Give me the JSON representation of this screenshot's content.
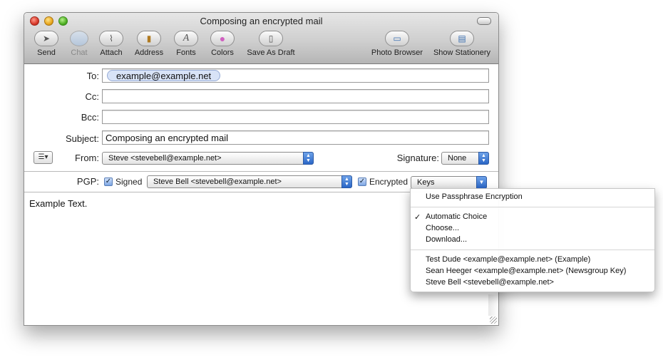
{
  "window": {
    "title": "Composing an encrypted mail"
  },
  "toolbar": {
    "items": [
      {
        "label": "Send",
        "icon": "send-icon",
        "glyph": "➤"
      },
      {
        "label": "Chat",
        "icon": "chat-icon",
        "glyph": ""
      },
      {
        "label": "Attach",
        "icon": "paperclip-icon",
        "glyph": "⌇"
      },
      {
        "label": "Address",
        "icon": "address-book-icon",
        "glyph": "▮"
      },
      {
        "label": "Fonts",
        "icon": "fonts-icon",
        "glyph": "A"
      },
      {
        "label": "Colors",
        "icon": "color-wheel-icon",
        "glyph": "●"
      },
      {
        "label": "Save As Draft",
        "icon": "draft-icon",
        "glyph": "▯"
      },
      {
        "label": "Photo Browser",
        "icon": "photo-browser-icon",
        "glyph": "▭"
      },
      {
        "label": "Show Stationery",
        "icon": "stationery-icon",
        "glyph": "▤"
      }
    ]
  },
  "header": {
    "to_label": "To:",
    "to_token": "example@example.net",
    "cc_label": "Cc:",
    "cc_value": "",
    "bcc_label": "Bcc:",
    "bcc_value": "",
    "subject_label": "Subject:",
    "subject_value": "Composing an encrypted mail",
    "from_label": "From:",
    "from_value": "Steve <stevebell@example.net>",
    "signature_label": "Signature:",
    "signature_value": "None"
  },
  "pgp": {
    "label": "PGP:",
    "signed_label": "Signed",
    "signed_checked": true,
    "signer_value": "Steve Bell <stevebell@example.net>",
    "encrypted_label": "Encrypted",
    "encrypted_checked": true,
    "keys_value": "Keys"
  },
  "body": {
    "text": "Example Text."
  },
  "keys_menu": {
    "passphrase": "Use Passphrase Encryption",
    "automatic": "Automatic Choice",
    "automatic_checked": true,
    "choose": "Choose...",
    "download": "Download...",
    "keys": [
      "Test Dude <example@example.net> (Example)",
      "Sean Heeger <example@example.net> (Newsgroup Key)",
      "Steve Bell <stevebell@example.net>"
    ]
  },
  "colors": {
    "accent": "#2a66c7",
    "token_bg": "#d8e3f7"
  }
}
